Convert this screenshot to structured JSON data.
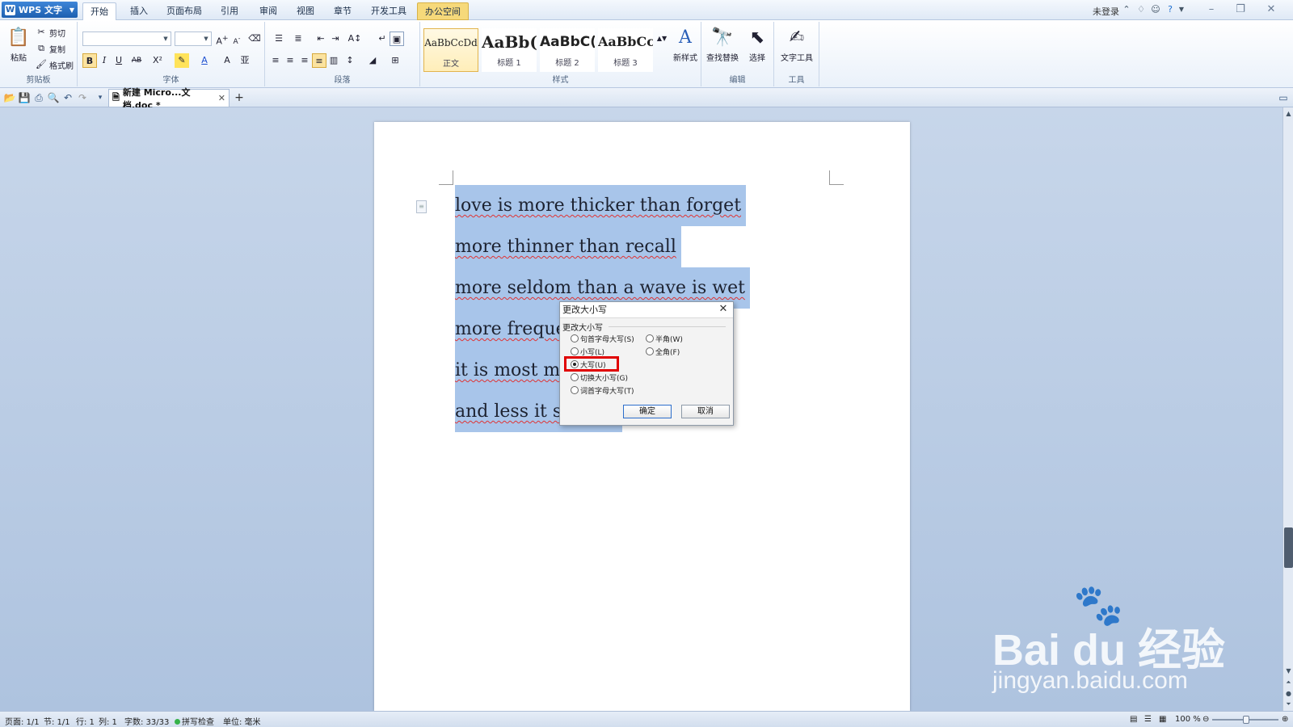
{
  "app": {
    "name": "WPS 文字",
    "logo_letter": "W"
  },
  "menu_tabs": [
    "开始",
    "插入",
    "页面布局",
    "引用",
    "审阅",
    "视图",
    "章节",
    "开发工具",
    "办公空间"
  ],
  "titlebar": {
    "login": "未登录"
  },
  "ribbon": {
    "clipboard": {
      "paste": "粘贴",
      "cut": "剪切",
      "copy": "复制",
      "format_painter": "格式刷",
      "label": "剪贴板"
    },
    "font": {
      "label": "字体",
      "font_name": "",
      "font_size": ""
    },
    "paragraph": {
      "label": "段落"
    },
    "styles": {
      "label": "样式",
      "items": [
        {
          "sample": "AaBbCcDd",
          "name": "正文"
        },
        {
          "sample": "AaBb(",
          "name": "标题 1"
        },
        {
          "sample": "AaBbC(",
          "name": "标题 2"
        },
        {
          "sample": "AaBbCc",
          "name": "标题 3"
        }
      ],
      "new_style": "新样式"
    },
    "editing": {
      "find_replace": "查找替换",
      "select": "选择",
      "label": "编辑"
    },
    "tools": {
      "text_tools": "文字工具",
      "label": "工具"
    }
  },
  "document_tab": {
    "title": "新建 Micro...文档.doc *"
  },
  "document": {
    "lines": [
      "love is more thicker than forget",
      "more thinner than recall",
      "more seldom than a wave is wet",
      "more frequer",
      "it is most ma",
      "and less it sh"
    ]
  },
  "dialog": {
    "title": "更改大小写",
    "group_label": "更改大小写",
    "options": [
      {
        "label": "句首字母大写(S)",
        "selected": false
      },
      {
        "label": "半角(W)",
        "selected": false
      },
      {
        "label": "小写(L)",
        "selected": false
      },
      {
        "label": "全角(F)",
        "selected": false
      },
      {
        "label": "大写(U)",
        "selected": true
      },
      {
        "label": "切换大小写(G)",
        "selected": false
      },
      {
        "label": "词首字母大写(T)",
        "selected": false
      }
    ],
    "ok": "确定",
    "cancel": "取消",
    "highlight_color": "#e00000"
  },
  "statusbar": {
    "page": "页面: 1/1",
    "section": "节: 1/1",
    "row": "行: 1",
    "col": "列: 1",
    "words": "字数: 33/33",
    "spellcheck": "拼写检查",
    "unit": "单位: 毫米",
    "zoom": "100 %"
  },
  "watermark": {
    "brand": "Bai du 经验",
    "url": "jingyan.baidu.com"
  },
  "colors": {
    "accent": "#1d5fb0",
    "selection": "#a8c5ea",
    "workspace": "#b9cbe4"
  }
}
